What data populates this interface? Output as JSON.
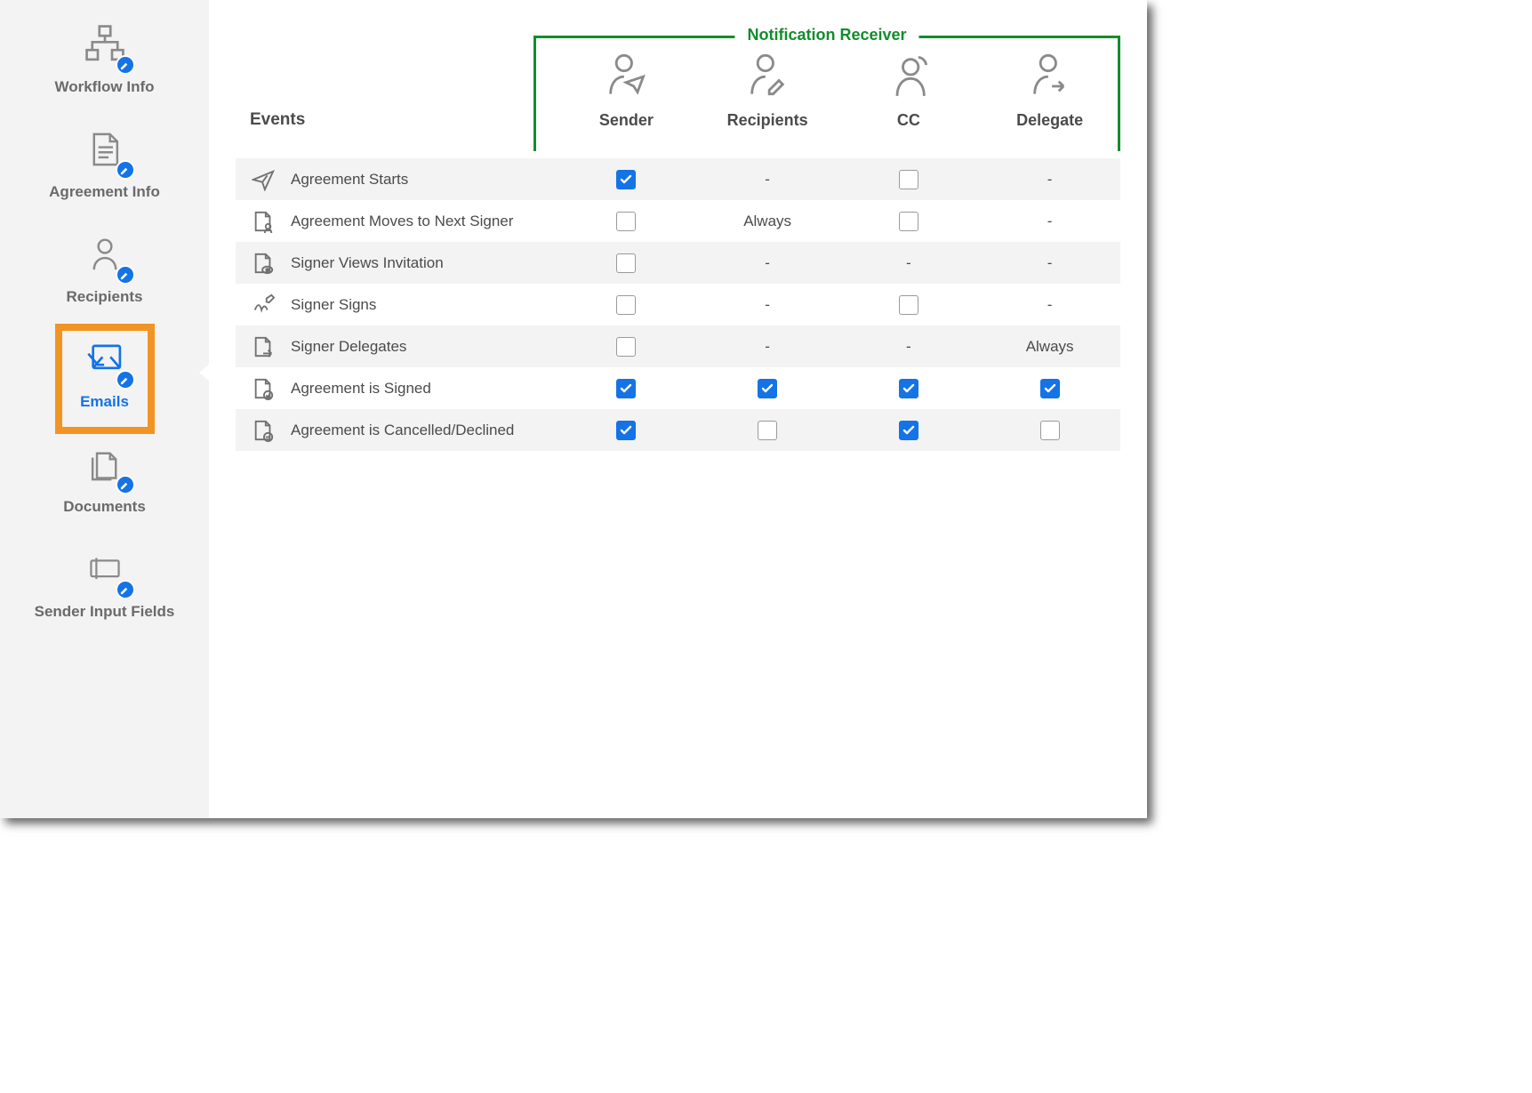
{
  "sidebar": {
    "items": [
      {
        "id": "workflow-info",
        "label": "Workflow Info",
        "active": false
      },
      {
        "id": "agreement-info",
        "label": "Agreement Info",
        "active": false
      },
      {
        "id": "recipients",
        "label": "Recipients",
        "active": false
      },
      {
        "id": "emails",
        "label": "Emails",
        "active": true
      },
      {
        "id": "documents",
        "label": "Documents",
        "active": false
      },
      {
        "id": "sender-input-fields",
        "label": "Sender Input Fields",
        "active": false
      }
    ]
  },
  "main": {
    "receiver_label": "Notification Receiver",
    "events_header": "Events",
    "columns": [
      {
        "id": "sender",
        "label": "Sender"
      },
      {
        "id": "recipients",
        "label": "Recipients"
      },
      {
        "id": "cc",
        "label": "CC"
      },
      {
        "id": "delegate",
        "label": "Delegate"
      }
    ],
    "rows": [
      {
        "id": "agreement-starts",
        "icon": "send-icon",
        "label": "Agreement Starts",
        "cells": [
          {
            "type": "checkbox",
            "checked": true
          },
          {
            "type": "text",
            "value": "-"
          },
          {
            "type": "checkbox",
            "checked": false
          },
          {
            "type": "text",
            "value": "-"
          }
        ]
      },
      {
        "id": "agreement-moves-next",
        "icon": "doc-person-icon",
        "label": "Agreement Moves to Next Signer",
        "cells": [
          {
            "type": "checkbox",
            "checked": false
          },
          {
            "type": "text",
            "value": "Always"
          },
          {
            "type": "checkbox",
            "checked": false
          },
          {
            "type": "text",
            "value": "-"
          }
        ]
      },
      {
        "id": "signer-views",
        "icon": "doc-eye-icon",
        "label": "Signer Views Invitation",
        "cells": [
          {
            "type": "checkbox",
            "checked": false
          },
          {
            "type": "text",
            "value": "-"
          },
          {
            "type": "text",
            "value": "-"
          },
          {
            "type": "text",
            "value": "-"
          }
        ]
      },
      {
        "id": "signer-signs",
        "icon": "signature-icon",
        "label": "Signer Signs",
        "cells": [
          {
            "type": "checkbox",
            "checked": false
          },
          {
            "type": "text",
            "value": "-"
          },
          {
            "type": "checkbox",
            "checked": false
          },
          {
            "type": "text",
            "value": "-"
          }
        ]
      },
      {
        "id": "signer-delegates",
        "icon": "doc-arrow-icon",
        "label": "Signer Delegates",
        "cells": [
          {
            "type": "checkbox",
            "checked": false
          },
          {
            "type": "text",
            "value": "-"
          },
          {
            "type": "text",
            "value": "-"
          },
          {
            "type": "text",
            "value": "Always"
          }
        ]
      },
      {
        "id": "agreement-signed",
        "icon": "doc-check-icon",
        "label": "Agreement is Signed",
        "cells": [
          {
            "type": "checkbox",
            "checked": true
          },
          {
            "type": "checkbox",
            "checked": true
          },
          {
            "type": "checkbox",
            "checked": true
          },
          {
            "type": "checkbox",
            "checked": true
          }
        ]
      },
      {
        "id": "agreement-cancelled",
        "icon": "doc-minus-icon",
        "label": "Agreement is Cancelled/Declined",
        "cells": [
          {
            "type": "checkbox",
            "checked": true
          },
          {
            "type": "checkbox",
            "checked": false
          },
          {
            "type": "checkbox",
            "checked": true
          },
          {
            "type": "checkbox",
            "checked": false
          }
        ]
      }
    ]
  }
}
